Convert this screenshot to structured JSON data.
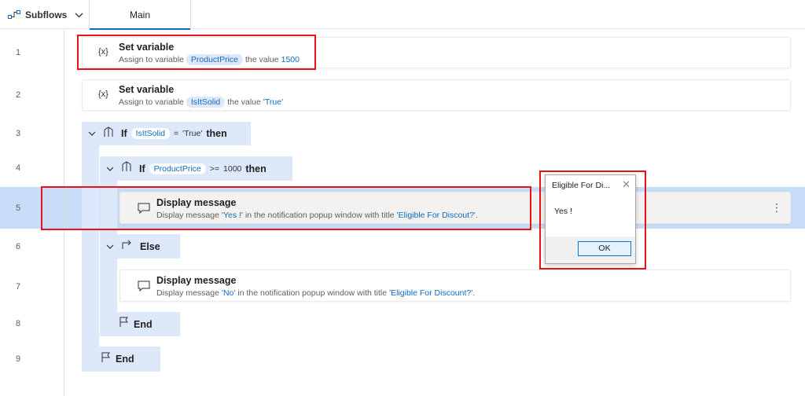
{
  "toolbar": {
    "subflows_label": "Subflows",
    "tab_main": "Main"
  },
  "line_numbers": [
    "1",
    "2",
    "3",
    "4",
    "5",
    "6",
    "7",
    "8",
    "9"
  ],
  "steps": {
    "set1": {
      "icon": "{x}",
      "title": "Set variable",
      "prefix": "Assign to variable",
      "variable": "ProductPrice",
      "mid": "the value",
      "value": "1500"
    },
    "set2": {
      "icon": "{x}",
      "title": "Set variable",
      "prefix": "Assign to variable",
      "variable": "IsItSolid",
      "mid": "the value",
      "value": "'True'"
    },
    "if1": {
      "keyword": "If",
      "variable": "IsItSolid",
      "op": "=",
      "value": "'True'",
      "then": "then"
    },
    "if2": {
      "keyword": "If",
      "variable": "ProductPrice",
      "op": ">=",
      "value": "1000",
      "then": "then"
    },
    "msg1": {
      "title": "Display message",
      "prefix": "Display message",
      "text": "'Yes !'",
      "mid": "in the notification popup window with title",
      "window_title": "'Eligible For Discout?'",
      "end": "."
    },
    "else": {
      "keyword": "Else"
    },
    "msg2": {
      "title": "Display message",
      "prefix": "Display message",
      "text": "'No'",
      "mid": "in the notification popup window with title",
      "window_title": "'Eligible For Discount?'",
      "end": "."
    },
    "end1": {
      "keyword": "End"
    },
    "end2": {
      "keyword": "End"
    }
  },
  "dialog": {
    "title": "Eligible For Di...",
    "message": "Yes !",
    "ok_label": "OK"
  },
  "colors": {
    "accent": "#0f6cbd",
    "highlight_row": "#c7dcf6",
    "block": "#dde9fa",
    "annotation": "#e8131a"
  }
}
